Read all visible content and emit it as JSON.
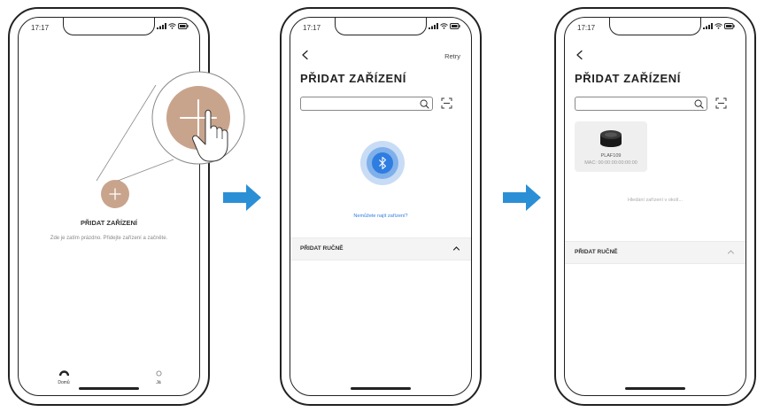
{
  "status": {
    "time": "17:17"
  },
  "phone1": {
    "title": "PŘIDAT ZAŘÍZENÍ",
    "empty_text": "Zde je zatím prázdno. Přidejte zařízení a začněte.",
    "tabs": [
      {
        "label": "Domů",
        "icon": "home-icon"
      },
      {
        "label": "Já",
        "icon": "user-icon"
      }
    ]
  },
  "phone2": {
    "retry_label": "Retry",
    "title": "PŘIDAT ZAŘÍZENÍ",
    "search": {
      "value": "",
      "placeholder": ""
    },
    "cant_find_link": "Nemůžete najít zařízení?",
    "manual_section": "PŘIDAT RUČNĚ"
  },
  "phone3": {
    "title": "PŘIDAT ZAŘÍZENÍ",
    "search": {
      "value": "",
      "placeholder": ""
    },
    "device": {
      "name": "PLAF109",
      "mac": "MAC: 00:00:00:00:00:00"
    },
    "searching_text": "Hledání zařízení v okolí...",
    "manual_section": "PŘIDAT RUČNĚ"
  },
  "colors": {
    "accent_tan": "#c9a48c",
    "bluetooth_blue": "#2f7de0",
    "arrow_blue": "#2b8fd6"
  }
}
